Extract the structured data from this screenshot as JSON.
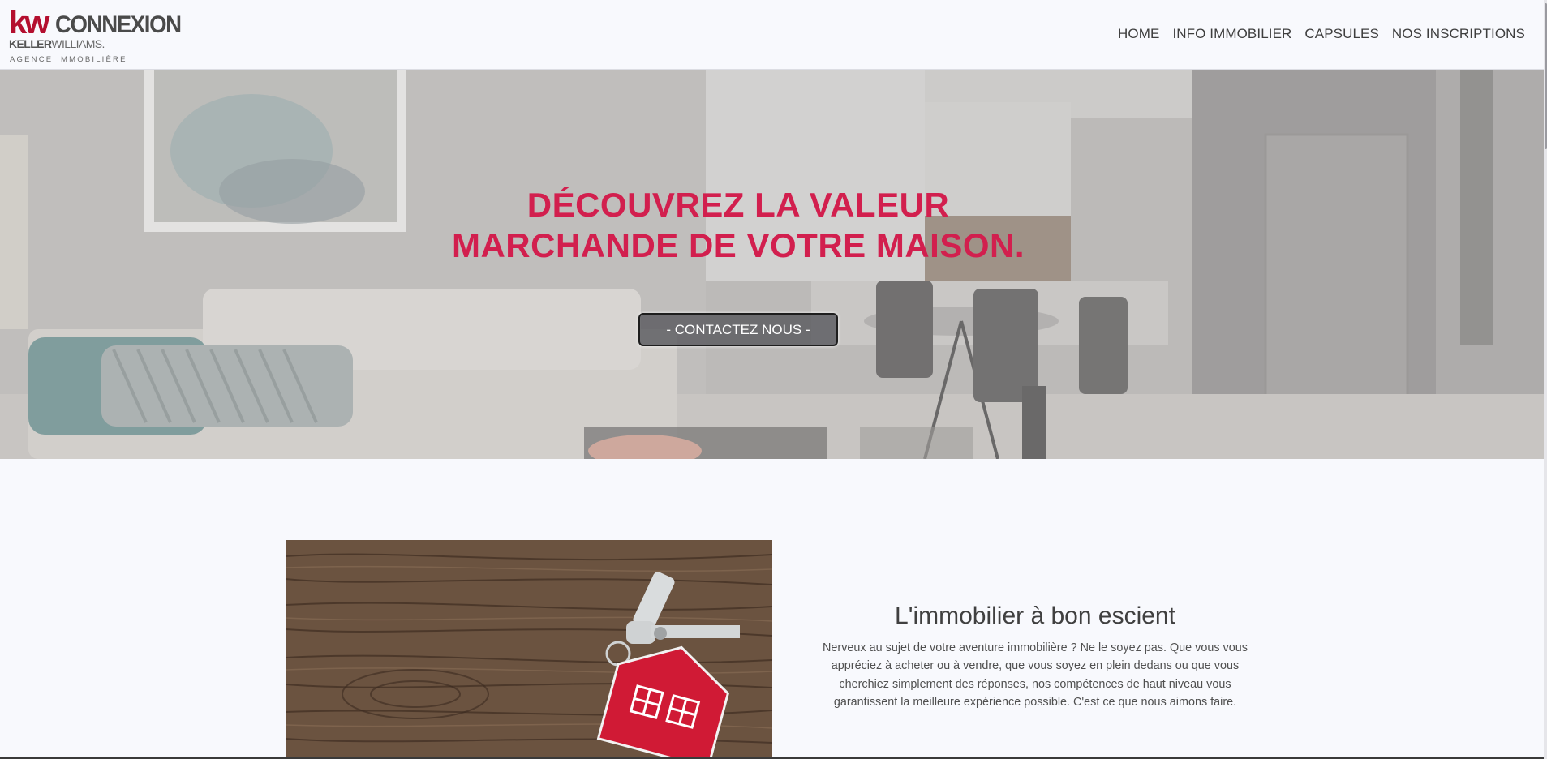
{
  "header": {
    "logo": {
      "kw": "kw",
      "brand": "CONNEXION",
      "keller": "KELLER",
      "williams": "WILLIAMS.",
      "tagline": "AGENCE IMMOBILIÈRE"
    },
    "nav": [
      {
        "label": "HOME"
      },
      {
        "label": "INFO IMMOBILIER"
      },
      {
        "label": "CAPSULES"
      },
      {
        "label": "NOS INSCRIPTIONS"
      }
    ]
  },
  "hero": {
    "title_line1": "DÉCOUVREZ LA VALEUR",
    "title_line2": "MARCHANDE DE VOTRE MAISON.",
    "cta_label": "- CONTACTEZ NOUS -"
  },
  "about": {
    "heading": "L'immobilier à bon escient",
    "body": "Nerveux au sujet de votre aventure immobilière ? Ne le soyez pas. Que vous vous appréciez à acheter ou à vendre, que vous soyez en plein dedans ou que vous cherchiez simplement des réponses, nos compétences de haut niveau vous garantissent la meilleure expérience possible. C'est ce que nous aimons faire."
  },
  "colors": {
    "accent": "#d21f4e",
    "brand_red": "#b40f2f",
    "background": "#f8f9fd",
    "text": "#404040"
  }
}
